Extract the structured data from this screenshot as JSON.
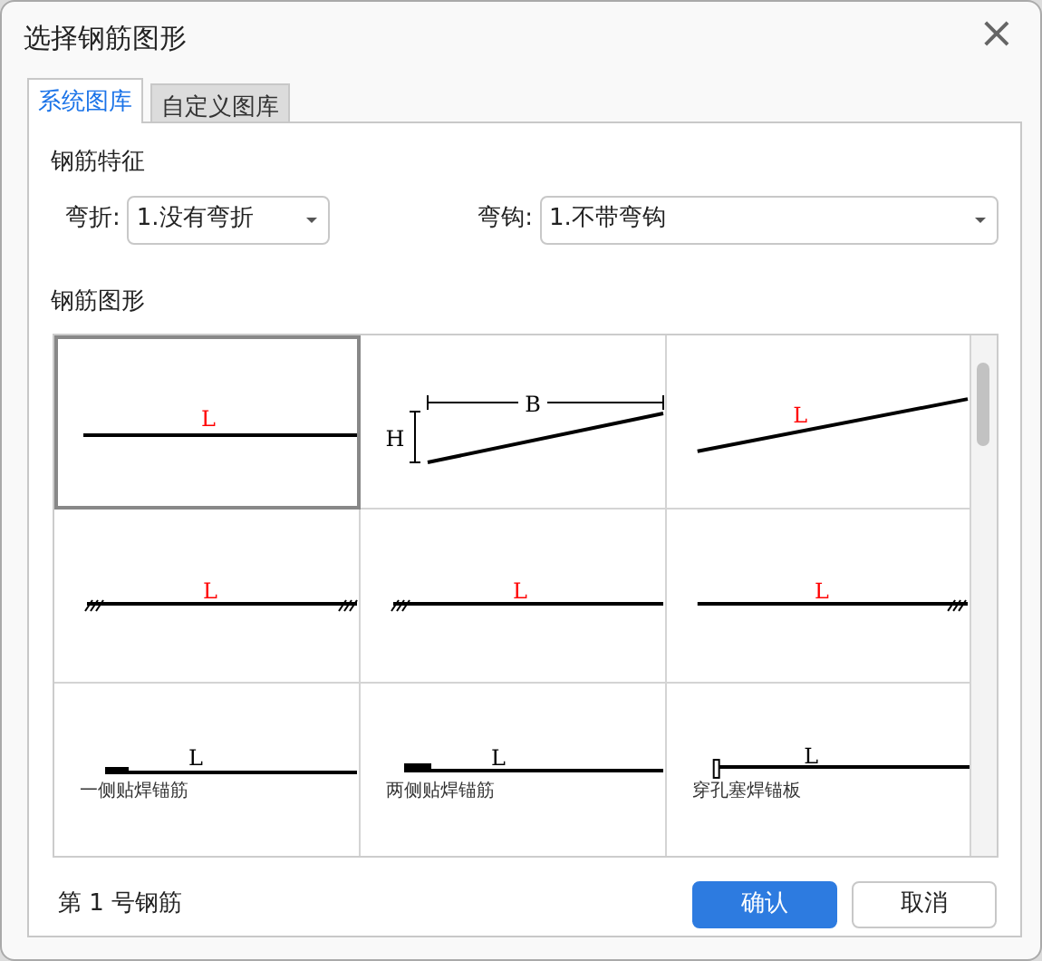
{
  "window": {
    "title": "选择钢筋图形",
    "close": "×"
  },
  "tabs": [
    {
      "label": "系统图库",
      "selected": true
    },
    {
      "label": "自定义图库",
      "selected": false
    }
  ],
  "features": {
    "heading": "钢筋特征",
    "fields": [
      {
        "label": "弯折:",
        "value": "1.没有弯折"
      },
      {
        "label": "弯钩:",
        "value": "1.不带弯钩"
      }
    ]
  },
  "shapes": {
    "heading": "钢筋图形",
    "cells": [
      {
        "kind": "straight",
        "selected": true,
        "labels": [
          {
            "text": "L",
            "color": "#ff0000"
          }
        ]
      },
      {
        "kind": "sloped-dim",
        "selected": false,
        "labels": [
          {
            "text": "H",
            "color": "#000000"
          },
          {
            "text": "B",
            "color": "#000000"
          }
        ]
      },
      {
        "kind": "sloped",
        "selected": false,
        "labels": [
          {
            "text": "L",
            "color": "#ff0000"
          }
        ]
      },
      {
        "kind": "hooked-both",
        "selected": false,
        "labels": [
          {
            "text": "L",
            "color": "#ff0000"
          }
        ]
      },
      {
        "kind": "hooked-left",
        "selected": false,
        "labels": [
          {
            "text": "L",
            "color": "#ff0000"
          }
        ]
      },
      {
        "kind": "hooked-right",
        "selected": false,
        "labels": [
          {
            "text": "L",
            "color": "#ff0000"
          }
        ]
      },
      {
        "kind": "anchor-one",
        "selected": false,
        "labels": [
          {
            "text": "L",
            "color": "#000000"
          }
        ],
        "caption": "一侧贴焊锚筋"
      },
      {
        "kind": "anchor-two",
        "selected": false,
        "labels": [
          {
            "text": "L",
            "color": "#000000"
          }
        ],
        "caption": "两侧贴焊锚筋"
      },
      {
        "kind": "anchor-plate",
        "selected": false,
        "labels": [
          {
            "text": "L",
            "color": "#000000"
          }
        ],
        "caption": "穿孔塞焊锚板"
      }
    ]
  },
  "status": "第 1 号钢筋",
  "buttons": [
    {
      "label": "确认",
      "kind": "primary"
    },
    {
      "label": "取消",
      "kind": "secondary"
    }
  ]
}
